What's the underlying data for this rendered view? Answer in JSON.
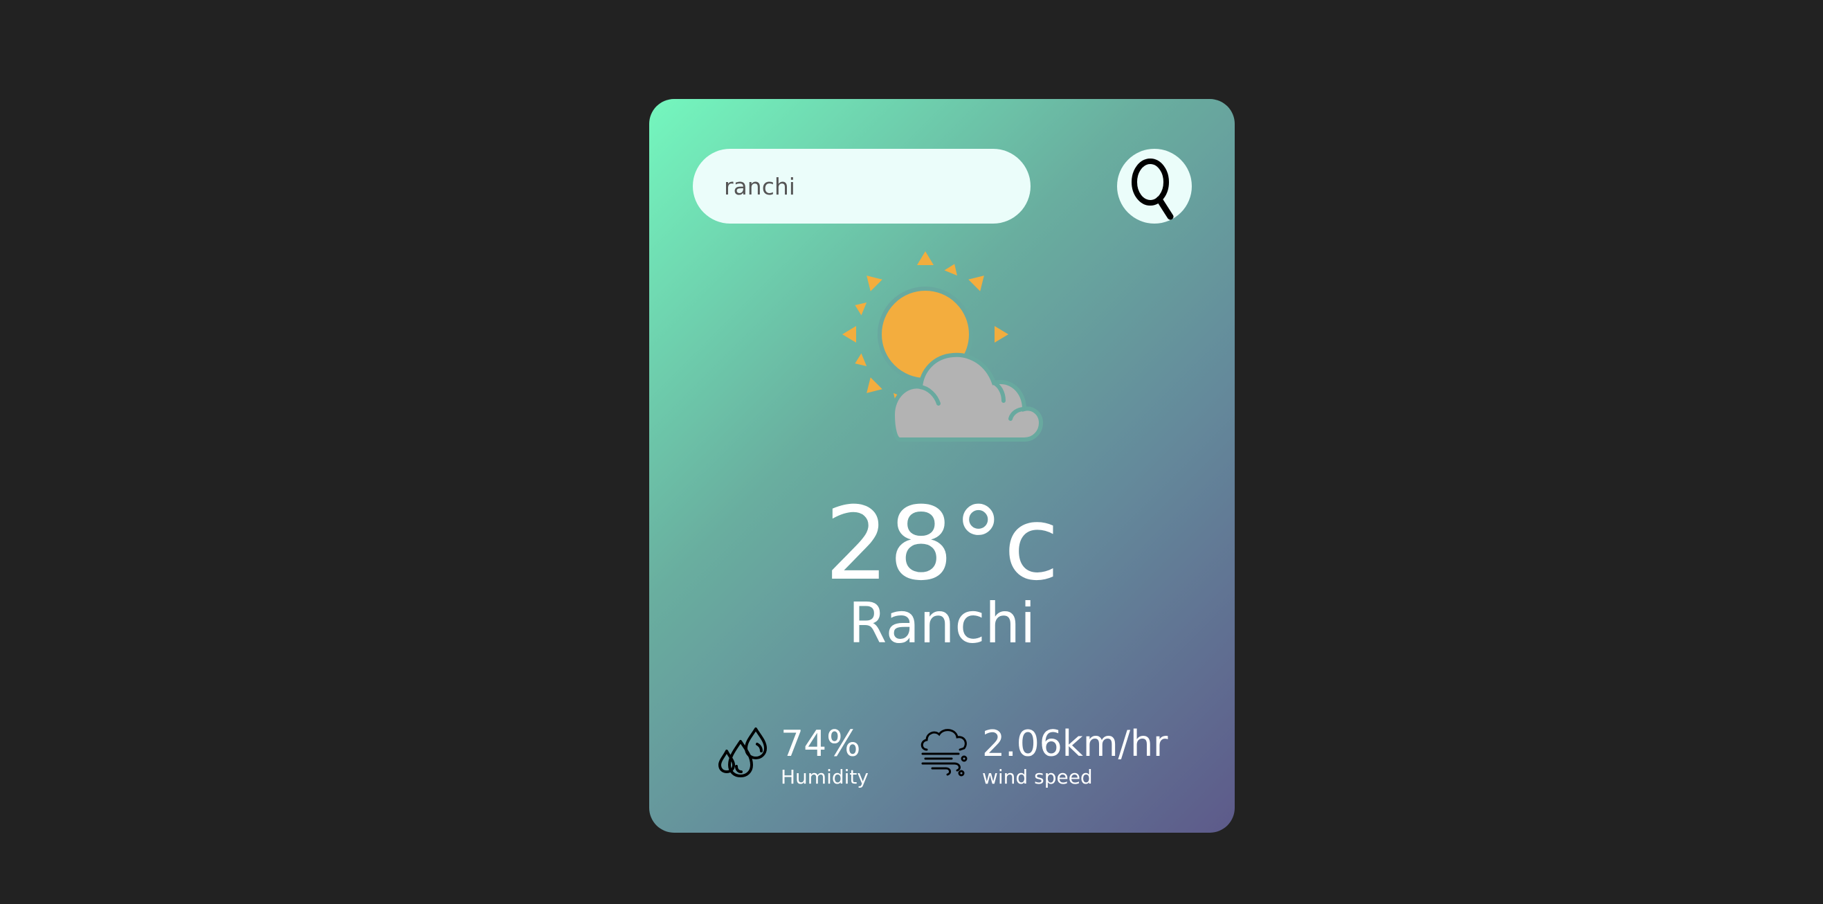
{
  "search": {
    "value": "ranchi",
    "placeholder": ""
  },
  "weather": {
    "icon": "sun-behind-cloud-icon",
    "temperature": "28°c",
    "city": "Ranchi"
  },
  "details": {
    "humidity": {
      "icon": "water-drops-icon",
      "value": "74%",
      "label": "Humidity"
    },
    "wind": {
      "icon": "wind-cloud-icon",
      "value": "2.06km/hr",
      "label": "wind speed"
    }
  },
  "colors": {
    "background": "#222222",
    "card_gradient_start": "#74f7be",
    "card_gradient_end": "#5d5a8a",
    "input_background": "#ebfdfa",
    "sun": "#f3ad3e",
    "cloud": "#b3b3b3"
  }
}
